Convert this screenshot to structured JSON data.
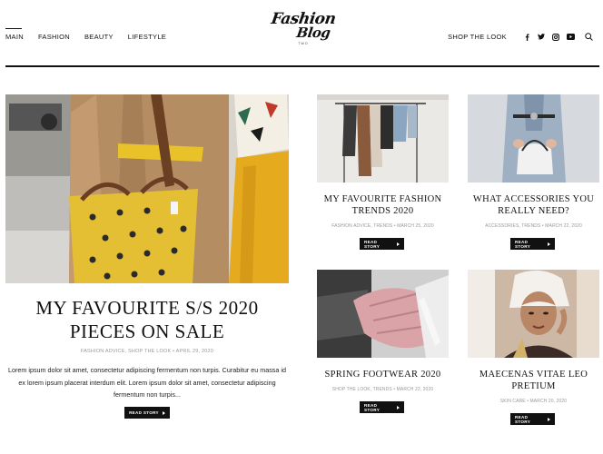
{
  "nav": {
    "items": [
      {
        "label": "MAIN",
        "active": true
      },
      {
        "label": "FASHION"
      },
      {
        "label": "BEAUTY"
      },
      {
        "label": "LIFESTYLE"
      }
    ],
    "shop_label": "SHOP THE LOOK",
    "social_icons": [
      "facebook-icon",
      "twitter-icon",
      "instagram-icon",
      "youtube-icon"
    ],
    "search_icon": "search-icon"
  },
  "logo": {
    "line1": "Fashion",
    "line2": "Blog",
    "sub": "TWO"
  },
  "featured": {
    "title_line1": "MY FAVOURITE S/S 2020",
    "title_line2": "PIECES ON SALE",
    "meta": "FASHION ADVICE, SHOP THE LOOK  •  APRIL 29, 2020",
    "excerpt": "Lorem ipsum dolor sit amet, consectetur adipiscing fermentum non turpis. Curabitur eu massa id ex lorem ipsum placerat interdum elit. Lorem ipsum dolor sit amet, consectetur adipiscing fermentum non turpis...",
    "button": "READ STORY"
  },
  "posts": [
    {
      "title_line1": "MY FAVOURITE FASHION",
      "title_line2": "TRENDS 2020",
      "meta": "FASHION ADVICE, TRENDS  •  MARCH 25, 2020",
      "button": "READ STORY"
    },
    {
      "title_line1": "WHAT ACCESSORIES YOU",
      "title_line2": "REALLY NEED?",
      "meta": "ACCESSORIES, TRENDS  •  MARCH 22, 2020",
      "button": "READ STORY"
    },
    {
      "title_line1": "SPRING FOOTWEAR 2020",
      "title_line2": "",
      "meta": "SHOP THE LOOK, TRENDS  •  MARCH 22, 2020",
      "button": "READ STORY"
    },
    {
      "title_line1": "MAECENAS VITAE LEO",
      "title_line2": "PRETIUM",
      "meta": "SKIN CARE  •  MARCH 20, 2020",
      "button": "READ STORY"
    }
  ]
}
